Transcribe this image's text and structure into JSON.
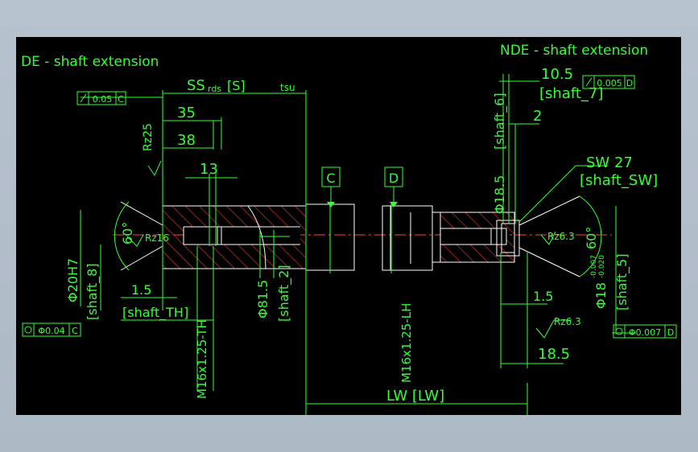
{
  "colors": {
    "canvas": "#000000",
    "dimension": "#33ff33",
    "outline": "#ffffff",
    "hatch": "#ff3b30",
    "datum": "#00ff66",
    "centerline": "#ff4040"
  },
  "labels": {
    "de_title": "DE - shaft extension",
    "nde_title": "NDE - shaft extension",
    "ss": "SS",
    "ss_sub": "rds",
    "ss_box": "[S]",
    "tsu": "tsu",
    "dim_35": "35",
    "dim_38": "38",
    "dim_13": "13",
    "rz25": "Rz25",
    "rz16": "Rz16",
    "angle_60_left": "60°",
    "phi20h7": "Φ20H7",
    "shaft8": "[shaft_8]",
    "dim_15_left": "1.5",
    "shaft_th": "[shaft_TH]",
    "thread_left": "M16x1.25-TH",
    "phi815": "Φ81.5",
    "shaft2": "[shaft_2]",
    "datum_c": "C",
    "datum_d": "D",
    "thread_right": "M16x1.25-LH",
    "lw": "LW  [LW]",
    "dim_105": "10.5",
    "shaft7": "[shaft_7]",
    "tol_top_right": "0.005",
    "tol_top_right_datum": "D",
    "dim_2": "2",
    "shaft6": "[shaft_6]",
    "phi185": "Φ18.5",
    "sw": "SW 27",
    "shaft_sw": "[shaft_SW]",
    "rz63_inner": "Rz6.3",
    "angle_60_right": "60°",
    "phi18": "Φ18",
    "phi18_tol_up": "-0.007",
    "phi18_tol_low": "-0.020",
    "shaft5": "[shaft_5]",
    "dim_15_right": "1.5",
    "rz63_lower": "Rz6.3",
    "dim_185": "18.5",
    "tol_top_left": "0.05",
    "tol_top_left_datum": "C",
    "tol_bottom_left": "Φ0.04",
    "tol_bottom_left_datum": "C",
    "tol_bottom_right": "Φ0.007",
    "tol_bottom_right_datum": "D"
  }
}
